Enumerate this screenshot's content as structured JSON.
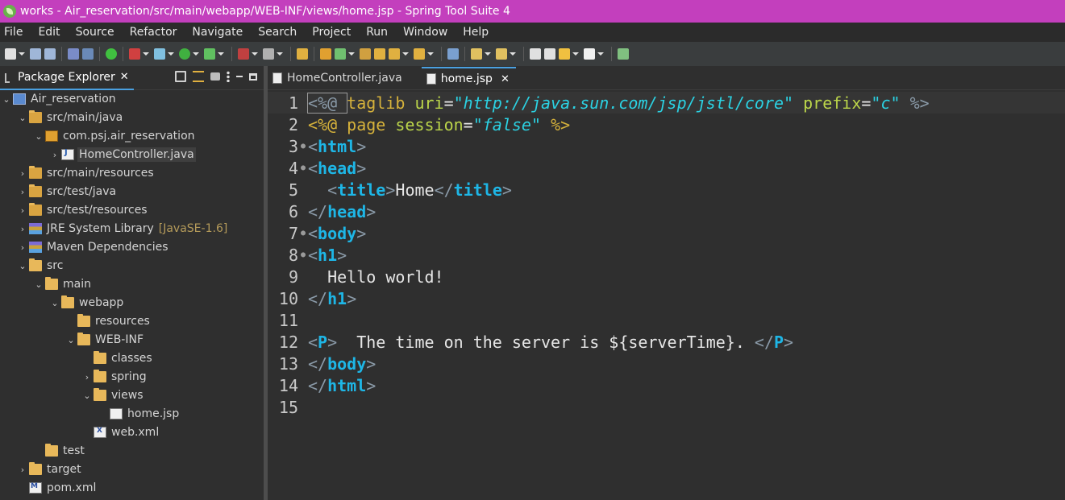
{
  "window": {
    "title": "works - Air_reservation/src/main/webapp/WEB-INF/views/home.jsp - Spring Tool Suite 4"
  },
  "menu": [
    "File",
    "Edit",
    "Source",
    "Refactor",
    "Navigate",
    "Search",
    "Project",
    "Run",
    "Window",
    "Help"
  ],
  "toolbar": {
    "icons": [
      "new-icon",
      "save-icon",
      "save-all-icon",
      "terminal-icon",
      "zoom-icon",
      "power-icon",
      "boot-dashboard-icon",
      "debug-icon",
      "run-icon",
      "coverage-icon",
      "stop-icon",
      "build-icon",
      "new-project-icon",
      "new-class-icon",
      "refresh-icon",
      "open-type-icon",
      "open-folder-icon",
      "brush-icon",
      "search-folder-icon",
      "globe-icon",
      "next-annotation-icon",
      "prev-annotation-icon",
      "back-icon",
      "forward-icon",
      "nav-back-icon",
      "nav-forward-icon",
      "new-window-icon"
    ]
  },
  "package_explorer": {
    "tab_label": "Package Explorer",
    "tree": [
      {
        "label": "Air_reservation",
        "depth": 0,
        "expanded": true,
        "icon": "project-icon"
      },
      {
        "label": "src/main/java",
        "depth": 1,
        "expanded": true,
        "icon": "source-folder-icon"
      },
      {
        "label": "com.psj.air_reservation",
        "depth": 2,
        "expanded": true,
        "icon": "package-icon"
      },
      {
        "label": "HomeController.java",
        "depth": 3,
        "expanded": false,
        "icon": "java-file-icon",
        "selected": true
      },
      {
        "label": "src/main/resources",
        "depth": 1,
        "expanded": false,
        "icon": "source-folder-icon"
      },
      {
        "label": "src/test/java",
        "depth": 1,
        "expanded": false,
        "icon": "source-folder-icon"
      },
      {
        "label": "src/test/resources",
        "depth": 1,
        "expanded": false,
        "icon": "source-folder-icon"
      },
      {
        "label": "JRE System Library",
        "decoration": "[JavaSE-1.6]",
        "depth": 1,
        "expanded": false,
        "icon": "library-icon"
      },
      {
        "label": "Maven Dependencies",
        "depth": 1,
        "expanded": false,
        "icon": "library-icon"
      },
      {
        "label": "src",
        "depth": 1,
        "expanded": true,
        "icon": "folder-icon"
      },
      {
        "label": "main",
        "depth": 2,
        "expanded": true,
        "icon": "folder-icon"
      },
      {
        "label": "webapp",
        "depth": 3,
        "expanded": true,
        "icon": "folder-icon"
      },
      {
        "label": "resources",
        "depth": 4,
        "expanded": null,
        "icon": "folder-icon"
      },
      {
        "label": "WEB-INF",
        "depth": 4,
        "expanded": true,
        "icon": "folder-icon"
      },
      {
        "label": "classes",
        "depth": 5,
        "expanded": null,
        "icon": "folder-icon"
      },
      {
        "label": "spring",
        "depth": 5,
        "expanded": false,
        "icon": "folder-icon"
      },
      {
        "label": "views",
        "depth": 5,
        "expanded": true,
        "icon": "folder-icon"
      },
      {
        "label": "home.jsp",
        "depth": 6,
        "expanded": null,
        "icon": "jsp-file-icon"
      },
      {
        "label": "web.xml",
        "depth": 5,
        "expanded": null,
        "icon": "xml-file-icon"
      },
      {
        "label": "test",
        "depth": 2,
        "expanded": null,
        "icon": "folder-icon"
      },
      {
        "label": "target",
        "depth": 1,
        "expanded": false,
        "icon": "folder-icon"
      },
      {
        "label": "pom.xml",
        "depth": 1,
        "expanded": null,
        "icon": "maven-file-icon"
      }
    ]
  },
  "editor": {
    "tabs": [
      {
        "label": "HomeController.java",
        "active": false
      },
      {
        "label": "home.jsp",
        "active": true
      }
    ],
    "lines": [
      {
        "n": "1",
        "fold": "",
        "tokens": [
          [
            "bracket",
            "<%@ "
          ],
          [
            "dir",
            "taglib"
          ],
          [
            "text",
            " "
          ],
          [
            "attr",
            "uri"
          ],
          [
            "text",
            "="
          ],
          [
            "str",
            "\"http://java.sun.com/jsp/jstl/core\""
          ],
          [
            "text",
            " "
          ],
          [
            "attr",
            "prefix"
          ],
          [
            "text",
            "="
          ],
          [
            "str",
            "\"c\""
          ],
          [
            "text",
            " "
          ],
          [
            "bracket",
            "%>"
          ]
        ]
      },
      {
        "n": "2",
        "fold": "",
        "tokens": [
          [
            "dir",
            "<%@ page "
          ],
          [
            "attr",
            "session"
          ],
          [
            "text",
            "="
          ],
          [
            "str",
            "\"false\""
          ],
          [
            "text",
            " "
          ],
          [
            "dir",
            "%>"
          ]
        ]
      },
      {
        "n": "3",
        "fold": "⊖",
        "tokens": [
          [
            "bracket",
            "<"
          ],
          [
            "tag",
            "html"
          ],
          [
            "bracket",
            ">"
          ]
        ]
      },
      {
        "n": "4",
        "fold": "⊖",
        "tokens": [
          [
            "bracket",
            "<"
          ],
          [
            "tag",
            "head"
          ],
          [
            "bracket",
            ">"
          ]
        ]
      },
      {
        "n": "5",
        "fold": "",
        "tokens": [
          [
            "text",
            "  "
          ],
          [
            "bracket",
            "<"
          ],
          [
            "tag",
            "title"
          ],
          [
            "bracket",
            ">"
          ],
          [
            "text",
            "Home"
          ],
          [
            "bracket",
            "</"
          ],
          [
            "tag",
            "title"
          ],
          [
            "bracket",
            ">"
          ]
        ]
      },
      {
        "n": "6",
        "fold": "",
        "tokens": [
          [
            "bracket",
            "</"
          ],
          [
            "tag",
            "head"
          ],
          [
            "bracket",
            ">"
          ]
        ]
      },
      {
        "n": "7",
        "fold": "⊖",
        "tokens": [
          [
            "bracket",
            "<"
          ],
          [
            "tag",
            "body"
          ],
          [
            "bracket",
            ">"
          ]
        ]
      },
      {
        "n": "8",
        "fold": "⊖",
        "tokens": [
          [
            "bracket",
            "<"
          ],
          [
            "tag",
            "h1"
          ],
          [
            "bracket",
            ">"
          ]
        ]
      },
      {
        "n": "9",
        "fold": "",
        "tokens": [
          [
            "text",
            "  Hello world!"
          ]
        ]
      },
      {
        "n": "10",
        "fold": "",
        "tokens": [
          [
            "bracket",
            "</"
          ],
          [
            "tag",
            "h1"
          ],
          [
            "bracket",
            ">"
          ]
        ]
      },
      {
        "n": "11",
        "fold": "",
        "tokens": []
      },
      {
        "n": "12",
        "fold": "",
        "tokens": [
          [
            "bracket",
            "<"
          ],
          [
            "tag",
            "P"
          ],
          [
            "bracket",
            ">"
          ],
          [
            "text",
            "  The time on the server is ${serverTime}. "
          ],
          [
            "bracket",
            "</"
          ],
          [
            "tag",
            "P"
          ],
          [
            "bracket",
            ">"
          ]
        ]
      },
      {
        "n": "13",
        "fold": "",
        "tokens": [
          [
            "bracket",
            "</"
          ],
          [
            "tag",
            "body"
          ],
          [
            "bracket",
            ">"
          ]
        ]
      },
      {
        "n": "14",
        "fold": "",
        "tokens": [
          [
            "bracket",
            "</"
          ],
          [
            "tag",
            "html"
          ],
          [
            "bracket",
            ">"
          ]
        ]
      },
      {
        "n": "15",
        "fold": "",
        "tokens": []
      }
    ]
  },
  "colors": {
    "titlebar": "#c33fbd",
    "tag": "#1eb6e6",
    "directive": "#d6b23b",
    "attribute": "#bcd64a",
    "string": "#2bd2e3",
    "decoration": "#b59b5a"
  }
}
